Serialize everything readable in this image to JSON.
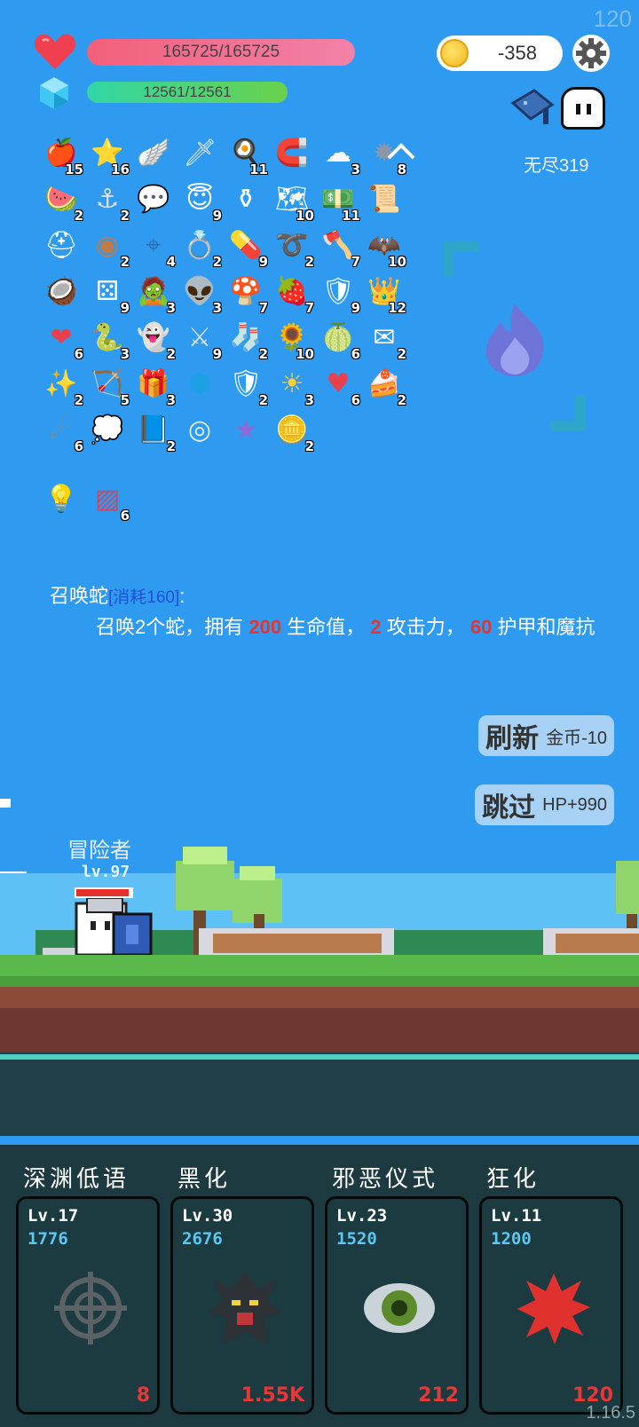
{
  "fps": "120",
  "version": "1.16.5",
  "status": {
    "hp_text": "165725/165725",
    "mp_text": "12561/12561",
    "coins": "-358",
    "mode_label": "无尽319"
  },
  "items": [
    [
      {
        "icon": "apple-icon",
        "count": "15"
      },
      {
        "icon": "star-card-icon",
        "count": "16"
      },
      {
        "icon": "wing-icon",
        "count": ""
      },
      {
        "icon": "sword-icon",
        "count": ""
      },
      {
        "icon": "egg-icon",
        "count": "11"
      },
      {
        "icon": "magnet-icon",
        "count": ""
      },
      {
        "icon": "cloud-icon",
        "count": "3"
      },
      {
        "icon": "spiked-ball-icon",
        "count": "8"
      }
    ],
    [
      {
        "icon": "watermelon-icon",
        "count": "2"
      },
      {
        "icon": "hook-icon",
        "count": "2"
      },
      {
        "icon": "speech-bubble-icon",
        "count": ""
      },
      {
        "icon": "halo-wing-icon",
        "count": "9"
      },
      {
        "icon": "cauldron-icon",
        "count": ""
      },
      {
        "icon": "map-icon",
        "count": "10"
      },
      {
        "icon": "money-icon",
        "count": "11"
      },
      {
        "icon": "scroll-icon",
        "count": ""
      }
    ],
    [
      {
        "icon": "helmet-icon",
        "count": ""
      },
      {
        "icon": "shield-round-icon",
        "count": "2"
      },
      {
        "icon": "crosshair-icon",
        "count": "4"
      },
      {
        "icon": "ring-icon",
        "count": "2"
      },
      {
        "icon": "pill-icon",
        "count": "9"
      },
      {
        "icon": "noose-icon",
        "count": "2"
      },
      {
        "icon": "axe-icon",
        "count": "7"
      },
      {
        "icon": "bat-icon",
        "count": "10"
      }
    ],
    [
      {
        "icon": "coconut-icon",
        "count": ""
      },
      {
        "icon": "dice-icon",
        "count": "9"
      },
      {
        "icon": "zombie-icon",
        "count": "3"
      },
      {
        "icon": "alien-icon",
        "count": "3"
      },
      {
        "icon": "mushroom-icon",
        "count": "7"
      },
      {
        "icon": "strawberry-icon",
        "count": "7"
      },
      {
        "icon": "shield-icon",
        "count": "9"
      },
      {
        "icon": "crown-icon",
        "count": "12"
      }
    ],
    [
      {
        "icon": "hearts-icon",
        "count": "6"
      },
      {
        "icon": "snake-hook-icon",
        "count": "3"
      },
      {
        "icon": "ghost-icon",
        "count": "2"
      },
      {
        "icon": "sword-2-icon",
        "count": "9"
      },
      {
        "icon": "sock-icon",
        "count": "2"
      },
      {
        "icon": "sunflower-icon",
        "count": "10"
      },
      {
        "icon": "lime-icon",
        "count": "6"
      },
      {
        "icon": "envelope-icon",
        "count": "2"
      }
    ],
    [
      {
        "icon": "magic-wand-icon",
        "count": "2"
      },
      {
        "icon": "bow-icon",
        "count": "5"
      },
      {
        "icon": "gift-icon",
        "count": "3"
      },
      {
        "icon": "sapphire-icon",
        "count": ""
      },
      {
        "icon": "red-shield-icon",
        "count": "2"
      },
      {
        "icon": "sun-icon",
        "count": "3"
      },
      {
        "icon": "heart-icon",
        "count": "6"
      },
      {
        "icon": "cake-icon",
        "count": "2"
      }
    ],
    [
      {
        "icon": "meteor-icon",
        "count": "6"
      },
      {
        "icon": "chat-icon",
        "count": ""
      },
      {
        "icon": "blue-scroll-icon",
        "count": "2"
      },
      {
        "icon": "disc-icon",
        "count": ""
      },
      {
        "icon": "star-shield-icon",
        "count": ""
      },
      {
        "icon": "coins-icon",
        "count": "2"
      }
    ]
  ],
  "extra_items": [
    {
      "icon": "bulb-card-icon",
      "count": ""
    },
    {
      "icon": "blade-card-icon",
      "count": "6"
    }
  ],
  "skill": {
    "name": "召唤蛇",
    "cost": "[消耗160]",
    "colon": ":",
    "desc_1": "召唤2个蛇，拥有",
    "hp": "200",
    "desc_2": "生命值，",
    "atk": "2",
    "desc_3": "攻击力，",
    "armor": "60",
    "desc_4": "护甲和魔抗"
  },
  "buttons": {
    "refresh_label": "刷新",
    "refresh_cost": "金币-10",
    "skip_label": "跳过",
    "skip_reward": "HP+990"
  },
  "player": {
    "name": "冒险者",
    "level": "lv.97",
    "hp_fraction": 0.95
  },
  "abilities": [
    {
      "name": "深渊低语",
      "level": "Lv.17",
      "cost": "1776",
      "count": "8",
      "icon": "crosshair-icon"
    },
    {
      "name": "黑化",
      "level": "Lv.30",
      "cost": "2676",
      "count": "1.55K",
      "icon": "dark-tree-icon"
    },
    {
      "name": "邪恶仪式",
      "level": "Lv.23",
      "cost": "1520",
      "count": "212",
      "icon": "eye-icon"
    },
    {
      "name": "狂化",
      "level": "Lv.11",
      "cost": "1200",
      "count": "120",
      "icon": "red-splat-icon"
    }
  ]
}
